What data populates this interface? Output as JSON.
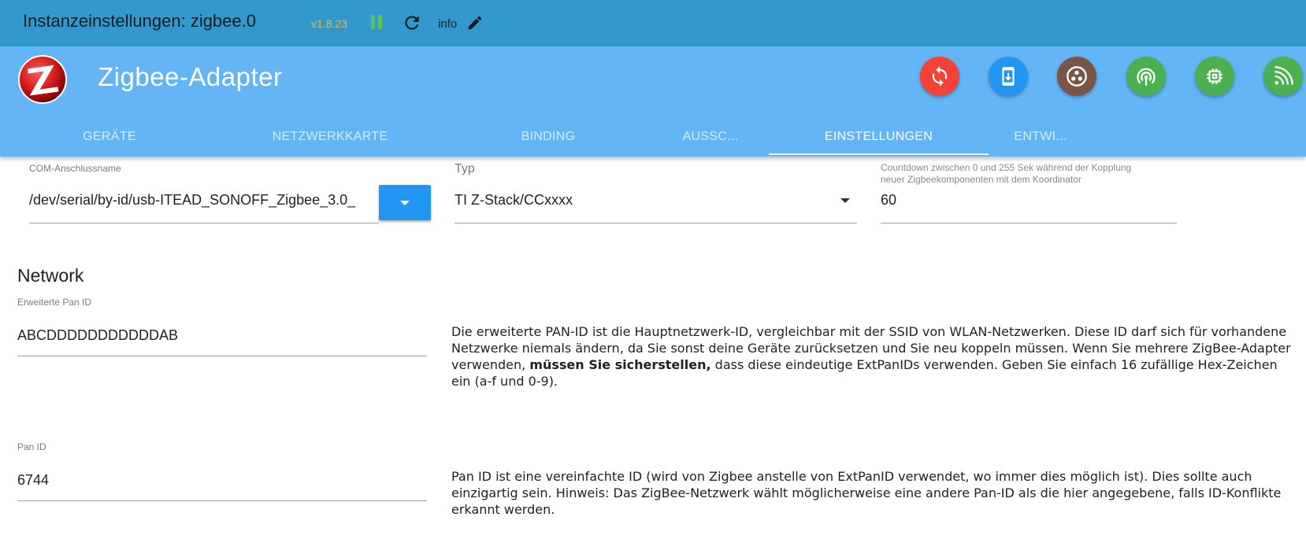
{
  "topbar": {
    "title": "Instanzeinstellungen: zigbee.0",
    "version": "v1.8.23",
    "info_label": "info",
    "icons": [
      "pause-icon",
      "reload-icon",
      "edit-icon"
    ],
    "bg_color": "#3399cc"
  },
  "adapter": {
    "title": "Zigbee-Adapter",
    "bg_color": "#64b5f6",
    "action_buttons": [
      {
        "icon": "sync-icon",
        "color": "#f44336"
      },
      {
        "icon": "mobile-download-icon",
        "color": "#2196f3"
      },
      {
        "icon": "dots-circle-icon",
        "color": "#795548"
      },
      {
        "icon": "wifi-signal-icon",
        "color": "#4caf50"
      },
      {
        "icon": "chip-icon",
        "color": "#4caf50"
      },
      {
        "icon": "signal-icon",
        "color": "#4caf50"
      }
    ]
  },
  "tabs": [
    {
      "label": "GERÄTE",
      "active": false
    },
    {
      "label": "NETZWERKKARTE",
      "active": false
    },
    {
      "label": "BINDING",
      "active": false
    },
    {
      "label": "AUSSC...",
      "active": false
    },
    {
      "label": "EINSTELLUNGEN",
      "active": true
    },
    {
      "label": "ENTWI...",
      "active": false
    }
  ],
  "form": {
    "com_port": {
      "label": "COM-Anschlussname",
      "value": "/dev/serial/by-id/usb-ITEAD_SONOFF_Zigbee_3.0_"
    },
    "type": {
      "label": "Typ",
      "value": "TI Z-Stack/CCxxxx"
    },
    "countdown": {
      "label": "Countdown zwischen 0 und 255 Sek während der Kopplung neuer Zigbeekomponenten mit dem Koordinator",
      "value": "60"
    }
  },
  "network": {
    "title": "Network",
    "ext_pan_id": {
      "label": "Erweiterte Pan ID",
      "value": "ABCDDDDDDDDDDDAB",
      "desc_part1": "Die erweiterte PAN-ID ist die Hauptnetzwerk-ID, vergleichbar mit der SSID von WLAN-Netzwerken. Diese ID darf sich für vorhandene Netzwerke niemals ändern, da Sie sonst deine Geräte zurücksetzen und Sie neu koppeln müssen. Wenn Sie mehrere ZigBee-Adapter verwenden, ",
      "desc_bold": "müssen Sie sicherstellen,",
      "desc_part2": " dass diese eindeutige ExtPanIDs verwenden. Geben Sie einfach 16 zufällige Hex-Zeichen ein (a-f und 0-9)."
    },
    "pan_id": {
      "label": "Pan ID",
      "value": "6744",
      "desc": "Pan ID ist eine vereinfachte ID (wird von Zigbee anstelle von ExtPanID verwendet, wo immer dies möglich ist). Dies sollte auch einzigartig sein. Hinweis: Das ZigBee-Netzwerk wählt möglicherweise eine andere Pan-ID als die hier angegebene, falls ID-Konflikte erkannt werden."
    }
  }
}
